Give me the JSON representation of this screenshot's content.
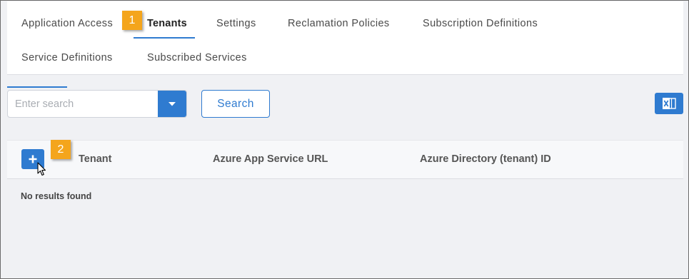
{
  "tabs": [
    {
      "label": "Application Access",
      "active": false
    },
    {
      "label": "Tenants",
      "active": true
    },
    {
      "label": "Settings",
      "active": false
    },
    {
      "label": "Reclamation Policies",
      "active": false
    },
    {
      "label": "Subscription Definitions",
      "active": false
    },
    {
      "label": "Service Definitions",
      "active": false
    },
    {
      "label": "Subscribed Services",
      "active": false
    }
  ],
  "callouts": [
    "1",
    "2"
  ],
  "search": {
    "placeholder": "Enter search",
    "button_label": "Search"
  },
  "toolbar": {
    "export_icon": "excel-icon"
  },
  "table": {
    "add_button_label": "+",
    "columns": [
      "Tenant",
      "Azure App Service URL",
      "Azure Directory (tenant) ID"
    ],
    "empty_message": "No results found"
  },
  "colors": {
    "accent": "#2f7bd0",
    "callout": "#f4a51c",
    "background": "#f0f1f4"
  }
}
